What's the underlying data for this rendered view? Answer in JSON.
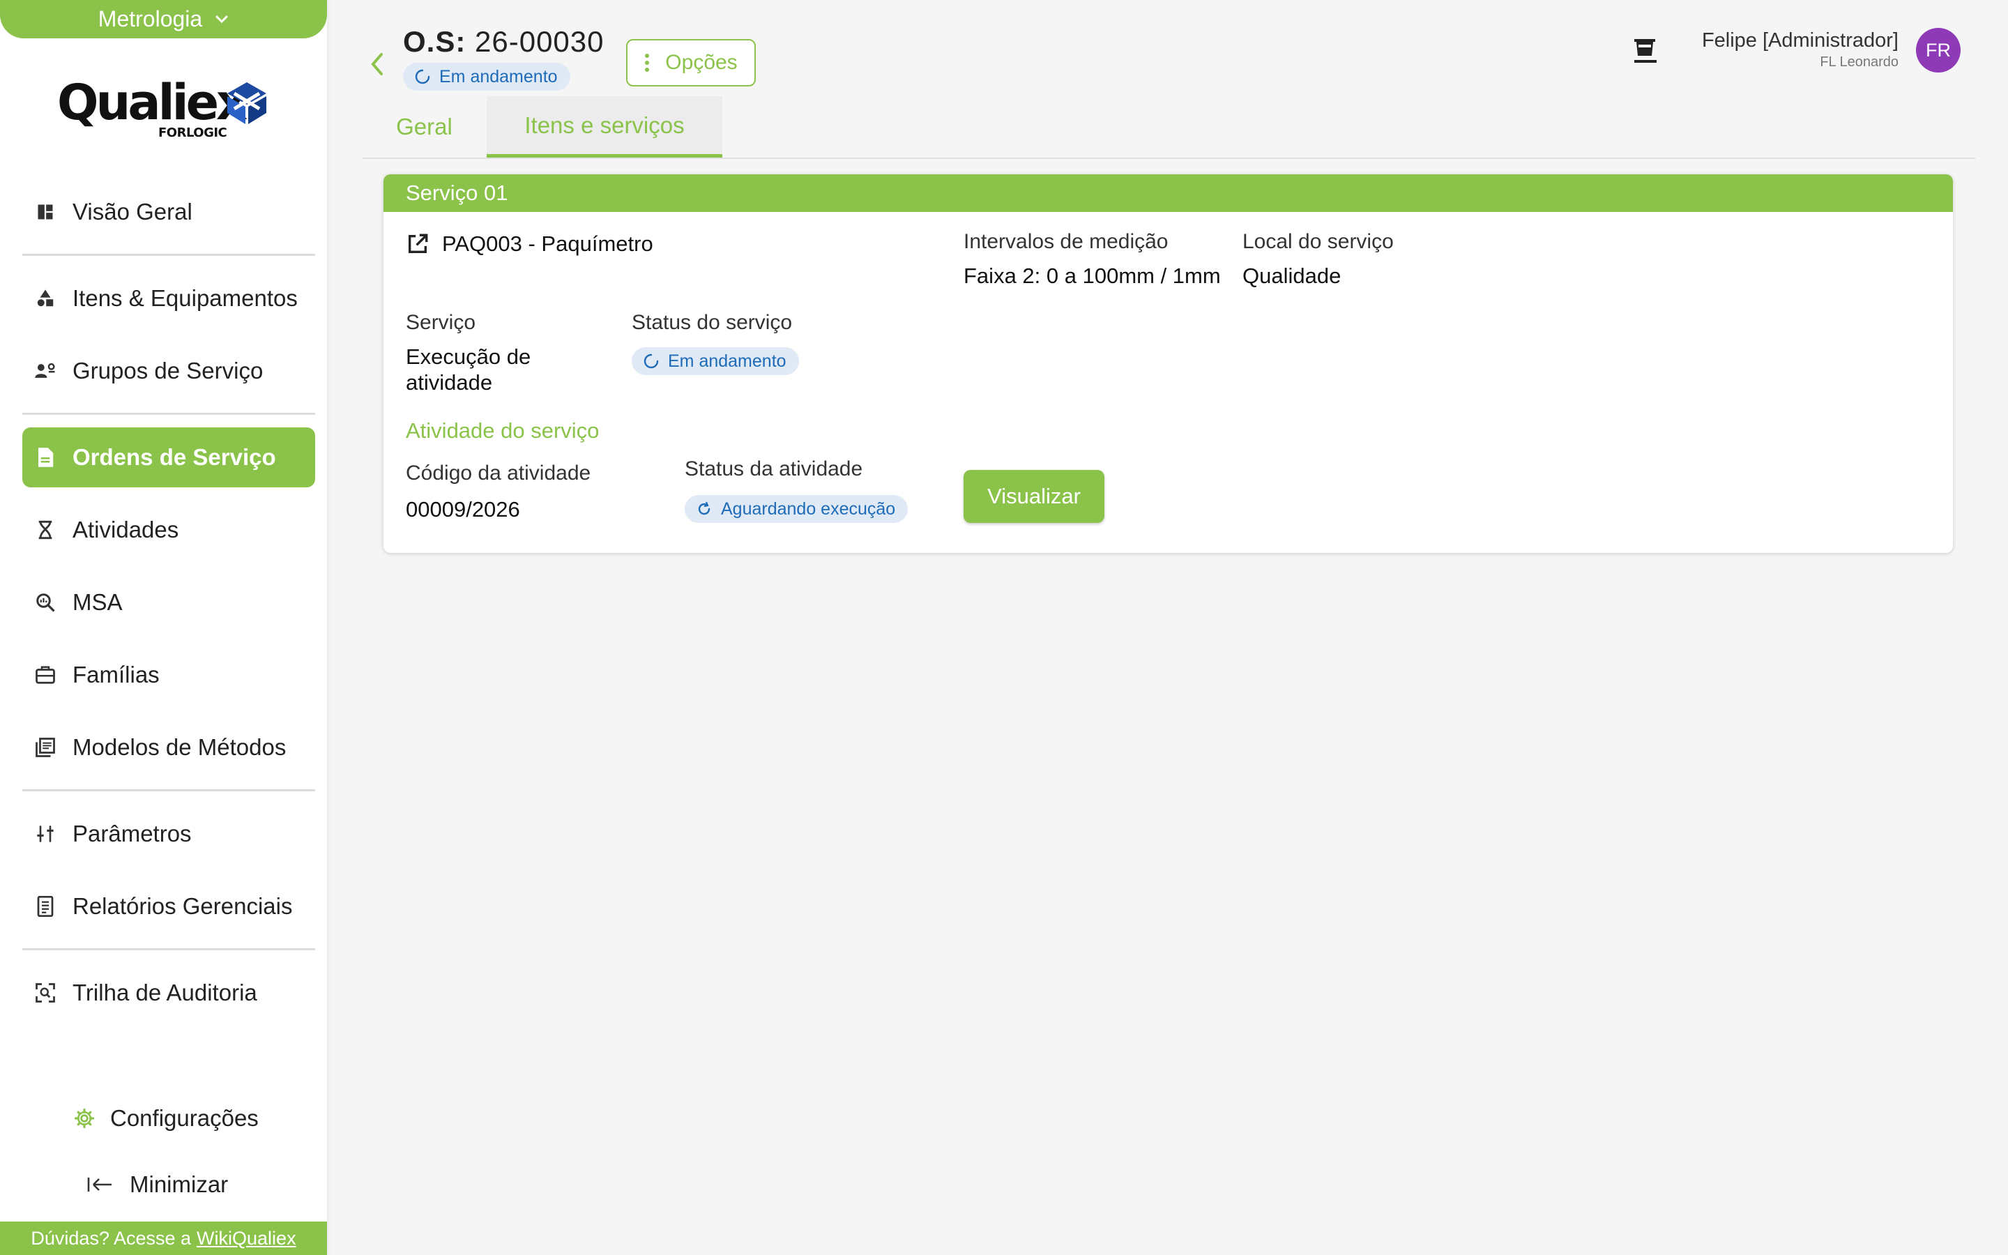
{
  "sidebar": {
    "module": "Metrologia",
    "logo": {
      "brand": "Qualiex",
      "sub": "FORLOGIC"
    },
    "items": [
      {
        "label": "Visão Geral",
        "icon": "dashboard-icon"
      },
      {
        "label": "Itens & Equipamentos",
        "icon": "shapes-icon"
      },
      {
        "label": "Grupos de Serviço",
        "icon": "group-settings-icon"
      },
      {
        "label": "Ordens de Serviço",
        "icon": "document-icon",
        "active": true
      },
      {
        "label": "Atividades",
        "icon": "hourglass-icon"
      },
      {
        "label": "MSA",
        "icon": "zoom-analysis-icon"
      },
      {
        "label": "Famílias",
        "icon": "toolbox-icon"
      },
      {
        "label": "Modelos de Métodos",
        "icon": "library-icon"
      },
      {
        "label": "Parâmetros",
        "icon": "sliders-icon"
      },
      {
        "label": "Relatórios Gerenciais",
        "icon": "report-icon"
      },
      {
        "label": "Trilha de Auditoria",
        "icon": "audit-scan-icon"
      }
    ],
    "settings_label": "Configurações",
    "minimize_label": "Minimizar",
    "help_text": "Dúvidas? Acesse a",
    "help_link": "WikiQualiex"
  },
  "header": {
    "os_prefix": "O.S:",
    "os_number": "26-00030",
    "status": "Em andamento",
    "options_label": "Opções",
    "tabs": [
      {
        "label": "Geral",
        "active": false
      },
      {
        "label": "Itens e serviços",
        "active": true
      }
    ],
    "user": {
      "name": "Felipe [Administrador]",
      "org": "FL Leonardo",
      "initials": "FR"
    }
  },
  "service": {
    "title": "Serviço 01",
    "item": "PAQ003 - Paquímetro",
    "intervals_label": "Intervalos de medição",
    "intervals_value": "Faixa 2: 0 a 100mm / 1mm",
    "location_label": "Local do serviço",
    "location_value": "Qualidade",
    "service_label": "Serviço",
    "service_value_line1": "Execução de",
    "service_value_line2": "atividade",
    "service_status_label": "Status do serviço",
    "service_status": "Em andamento",
    "activity_section": "Atividade do serviço",
    "activity_code_label": "Código da atividade",
    "activity_code": "00009/2026",
    "activity_status_label": "Status da atividade",
    "activity_status": "Aguardando execução",
    "view_button": "Visualizar"
  },
  "colors": {
    "accent": "#8bc34a",
    "chip_bg": "#dfeaf6",
    "chip_text": "#1e6bb8",
    "avatar": "#8e3ab7"
  }
}
